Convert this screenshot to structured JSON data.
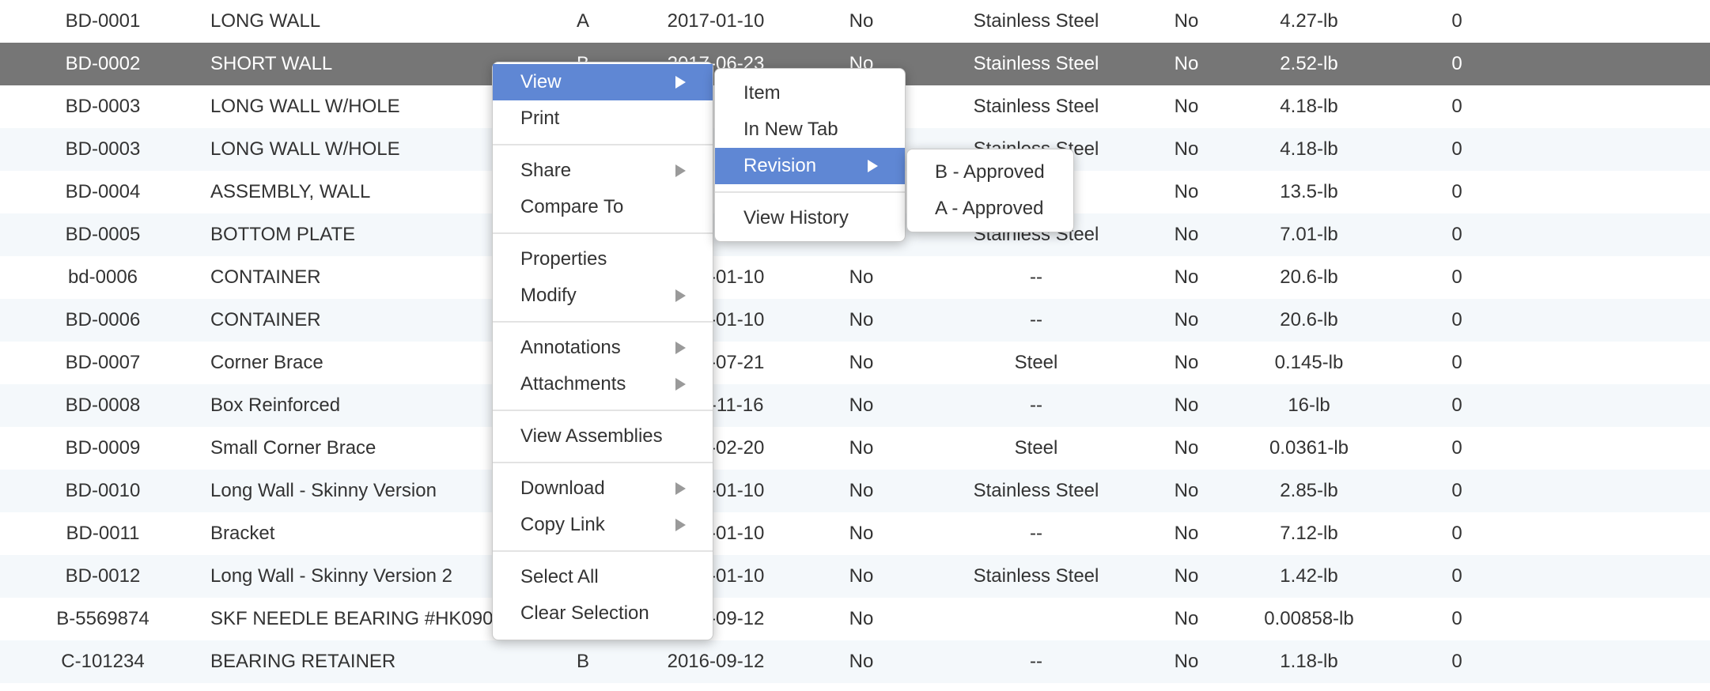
{
  "table": {
    "rows": [
      {
        "number": "BD-0001",
        "name": "LONG WALL",
        "rev": "A",
        "date": "2017-01-10",
        "flag1": "No",
        "material": "Stainless Steel",
        "flag2": "No",
        "weight": "4.27-lb",
        "count": "0"
      },
      {
        "number": "BD-0002",
        "name": "SHORT WALL",
        "rev": "B",
        "date": "2017-06-23",
        "flag1": "No",
        "material": "Stainless Steel",
        "flag2": "No",
        "weight": "2.52-lb",
        "count": "0",
        "selected": true
      },
      {
        "number": "BD-0003",
        "name": "LONG WALL W/HOLE",
        "rev": "",
        "date": "",
        "flag1": "",
        "material": "Stainless Steel",
        "flag2": "No",
        "weight": "4.18-lb",
        "count": "0"
      },
      {
        "number": "BD-0003",
        "name": "LONG WALL W/HOLE",
        "rev": "",
        "date": "",
        "flag1": "",
        "material": "Stainless Steel",
        "flag2": "No",
        "weight": "4.18-lb",
        "count": "0"
      },
      {
        "number": "BD-0004",
        "name": "ASSEMBLY, WALL",
        "rev": "",
        "date": "",
        "flag1": "",
        "material": "",
        "flag2": "No",
        "weight": "13.5-lb",
        "count": "0"
      },
      {
        "number": "BD-0005",
        "name": "BOTTOM PLATE",
        "rev": "",
        "date": "",
        "flag1": "",
        "material": "Stainless Steel",
        "flag2": "No",
        "weight": "7.01-lb",
        "count": "0"
      },
      {
        "number": "bd-0006",
        "name": "CONTAINER",
        "rev": "",
        "date": "2017-01-10",
        "flag1": "No",
        "material": "--",
        "flag2": "No",
        "weight": "20.6-lb",
        "count": "0"
      },
      {
        "number": "BD-0006",
        "name": "CONTAINER",
        "rev": "",
        "date": "2017-01-10",
        "flag1": "No",
        "material": "--",
        "flag2": "No",
        "weight": "20.6-lb",
        "count": "0"
      },
      {
        "number": "BD-0007",
        "name": "Corner Brace",
        "rev": "",
        "date": "2017-07-21",
        "flag1": "No",
        "material": "Steel",
        "flag2": "No",
        "weight": "0.145-lb",
        "count": "0"
      },
      {
        "number": "BD-0008",
        "name": "Box Reinforced",
        "rev": "",
        "date": "2017-11-16",
        "flag1": "No",
        "material": "--",
        "flag2": "No",
        "weight": "16-lb",
        "count": "0"
      },
      {
        "number": "BD-0009",
        "name": "Small Corner Brace",
        "rev": "",
        "date": "2018-02-20",
        "flag1": "No",
        "material": "Steel",
        "flag2": "No",
        "weight": "0.0361-lb",
        "count": "0"
      },
      {
        "number": "BD-0010",
        "name": "Long Wall - Skinny Version",
        "rev": "",
        "date": "2017-01-10",
        "flag1": "No",
        "material": "Stainless Steel",
        "flag2": "No",
        "weight": "2.85-lb",
        "count": "0"
      },
      {
        "number": "BD-0011",
        "name": "Bracket",
        "rev": "",
        "date": "2017-01-10",
        "flag1": "No",
        "material": "--",
        "flag2": "No",
        "weight": "7.12-lb",
        "count": "0"
      },
      {
        "number": "BD-0012",
        "name": "Long Wall - Skinny Version 2",
        "rev": "",
        "date": "2017-01-10",
        "flag1": "No",
        "material": "Stainless Steel",
        "flag2": "No",
        "weight": "1.42-lb",
        "count": "0"
      },
      {
        "number": "B-5569874",
        "name": "SKF NEEDLE BEARING #HK0908",
        "rev": "",
        "date": "2016-09-12",
        "flag1": "No",
        "material": "",
        "flag2": "No",
        "weight": "0.00858-lb",
        "count": "0"
      },
      {
        "number": "C-101234",
        "name": "BEARING RETAINER",
        "rev": "B",
        "date": "2016-09-12",
        "flag1": "No",
        "material": "--",
        "flag2": "No",
        "weight": "1.18-lb",
        "count": "0"
      }
    ]
  },
  "context_menu": {
    "main": [
      {
        "label": "View",
        "submenu": true,
        "active": true
      },
      {
        "label": "Print"
      },
      {
        "separator": true
      },
      {
        "label": "Share",
        "submenu": true
      },
      {
        "label": "Compare To"
      },
      {
        "separator": true
      },
      {
        "label": "Properties"
      },
      {
        "label": "Modify",
        "submenu": true
      },
      {
        "separator": true
      },
      {
        "label": "Annotations",
        "submenu": true
      },
      {
        "label": "Attachments",
        "submenu": true
      },
      {
        "separator": true
      },
      {
        "label": "View Assemblies"
      },
      {
        "separator": true
      },
      {
        "label": "Download",
        "submenu": true
      },
      {
        "label": "Copy Link",
        "submenu": true
      },
      {
        "separator": true
      },
      {
        "label": "Select All"
      },
      {
        "label": "Clear Selection"
      }
    ],
    "view_submenu": [
      {
        "label": "Item"
      },
      {
        "label": "In New Tab"
      },
      {
        "label": "Revision",
        "submenu": true,
        "active": true
      },
      {
        "separator": true
      },
      {
        "label": "View History"
      }
    ],
    "revision_submenu": [
      {
        "label": "B - Approved"
      },
      {
        "label": "A - Approved"
      }
    ]
  },
  "colors": {
    "selected_row": "#767676",
    "menu_highlight": "#5f87d4",
    "stripe": "#f4f8fb"
  }
}
